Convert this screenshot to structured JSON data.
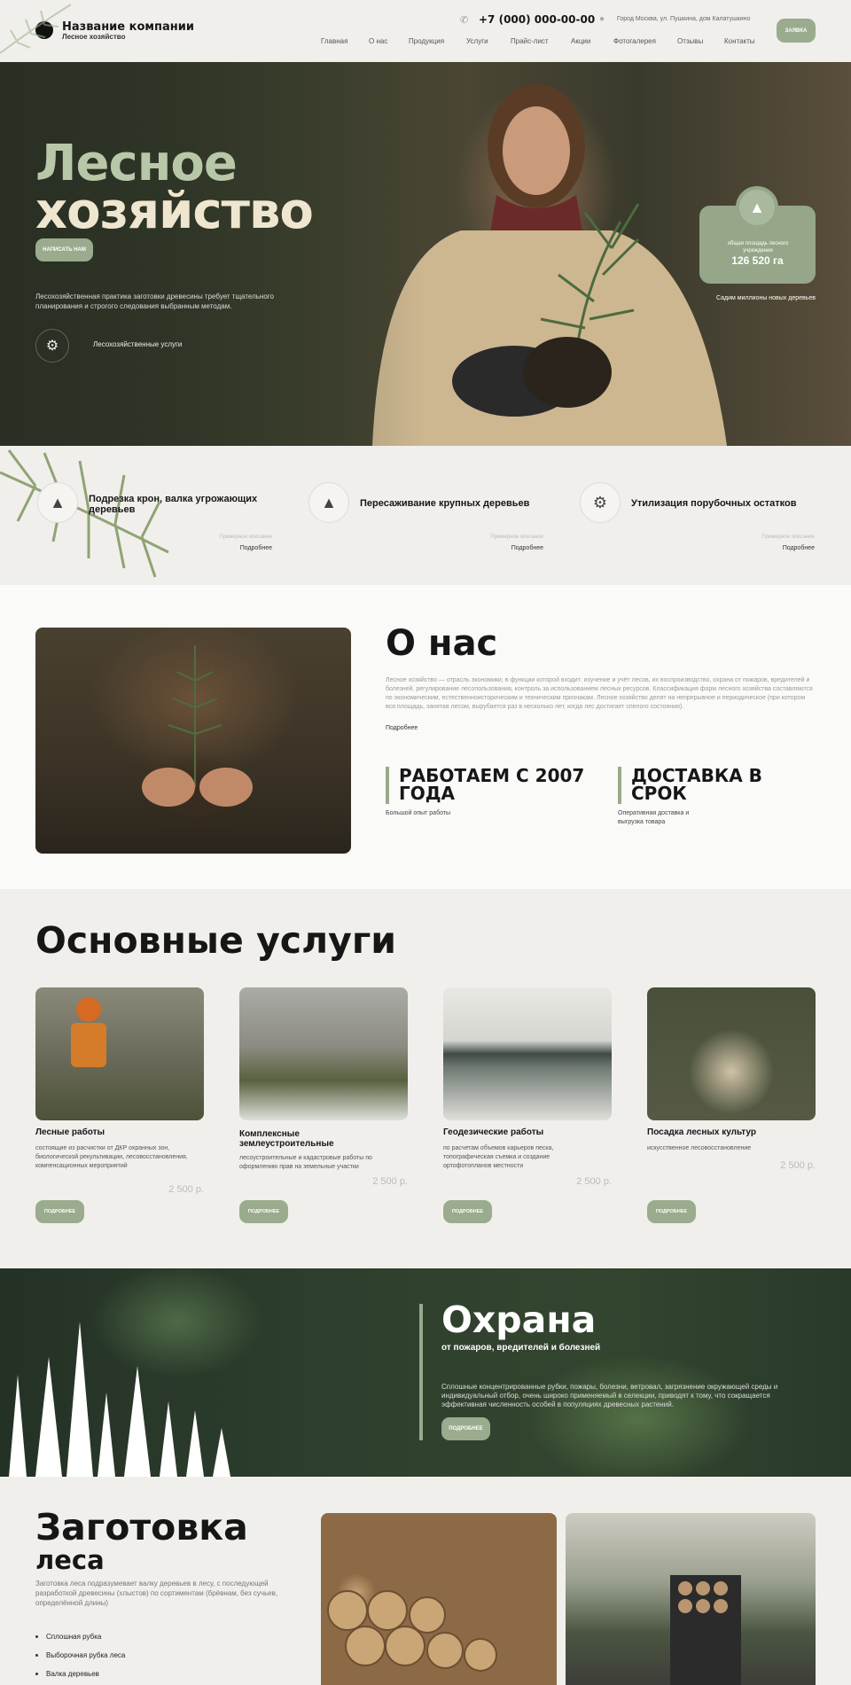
{
  "header": {
    "company_name": "Название компании",
    "company_sub": "Лесное хозяйство",
    "phone": "+7 (000) 000-00-00",
    "address": "Город Москва, ул. Пушкина, дом Калатушкино",
    "cta": "ЗАЯВКА",
    "nav": [
      "Главная",
      "О нас",
      "Продукция",
      "Услуги",
      "Прайс-лист",
      "Акции",
      "Фотогалерея",
      "Отзывы",
      "Контакты"
    ]
  },
  "hero": {
    "title_line1": "Лесное",
    "title_line2": "хозяйство",
    "button": "НАПИСАТЬ НАМ",
    "description": "Лесохозяйственная практика заготовки древесины требует тщательного планирования и строгого следования выбранным методам.",
    "service_label": "Лесохозяйственные услуги",
    "stat_label": "общая площадь лесного учреждения",
    "stat_value": "126 520 га",
    "stat_caption": "Садим миллионы новых деревьев"
  },
  "features": [
    {
      "title": "Подрезка крон, валка угрожающих деревьев",
      "sample": "Примерное описание",
      "more": "Подробнее"
    },
    {
      "title": "Пересаживание крупных деревьев",
      "sample": "Примерное описание",
      "more": "Подробнее"
    },
    {
      "title": "Утилизация порубочных остатков",
      "sample": "Примерное описание",
      "more": "Подробнее"
    }
  ],
  "about": {
    "title": "О нас",
    "text": "Лесное хозяйство — отрасль экономики, в функции которой входит: изучение и учёт лесов, их воспроизводство, охрана от пожаров, вредителей и болезней, регулирование лесопользования, контроль за использованием лесных ресурсов. Классификация форм лесного хозяйства составляются по экономическим, естественноисторическим и техническим признакам. Лесное хозяйство делят на непрерывное и периодическое (при котором вся площадь, занятая лесом, вырубается раз в несколько лет, когда лес достигает спелого состояния).",
    "more": "Подробнее",
    "h1": "РАБОТАЕМ С 2007 ГОДА",
    "s1": "Большой опыт работы",
    "h2": "ДОСТАВКА В СРОК",
    "s2": "Оперативная доставка и выгрузка товара"
  },
  "services": {
    "title": "Основные услуги",
    "items": [
      {
        "name": "Лесные работы",
        "desc": "состоящие из расчистки от ДКР охранных зон, биологической рекультивации, лесовосстановления, компенсационных мероприятий",
        "price": "2 500  р.",
        "button": "ПОДРОБНЕЕ"
      },
      {
        "name": "Комплексные землеустроительные",
        "desc": "лесоустроительные и кадастровые работы по оформлению прав на земельные участки",
        "price": "2 500  р.",
        "button": "ПОДРОБНЕЕ"
      },
      {
        "name": "Геодезические работы",
        "desc": "по расчетам объемов карьеров песка, топографическая съемка и создание ортофотопланов местности",
        "price": "2 500  р.",
        "button": "ПОДРОБНЕЕ"
      },
      {
        "name": "Посадка лесных культур",
        "desc": "искусственное лесовосстановление",
        "price": "2 500  р.",
        "button": "ПОДРОБНЕЕ"
      }
    ]
  },
  "protect": {
    "title": "Охрана",
    "subtitle": "от пожаров, вредителей и болезней",
    "text": "Сплошные концентрированные рубки, пожары, болезни, ветровал, загрязнение окружающей среды и индивидуальный отбор, очень широко применяемый в селекции, приводят к тому, что сокращается эффективная численность особей в популяциях древесных растений.",
    "button": "ПОДРОБНЕЕ"
  },
  "harvest": {
    "title": "Заготовка",
    "subtitle": "леса",
    "desc": "Заготовка леса подразумевает валку деревьев в лесу, с последующей разработкой древесины (хлыстов) по сортиментам (брёвнам, без сучьев, определённой длины)",
    "list": [
      "Сплошная рубка",
      "Выборочная рубка леса",
      "Валка деревьев"
    ]
  },
  "colors": {
    "accent": "#98a98c",
    "background": "#f1efec",
    "hero_title_green": "#b9c7a9",
    "hero_title_cream": "#efe6cf"
  },
  "icons": [
    "phone-icon",
    "location-pin-icon",
    "harvester-icon",
    "tree-icon",
    "trees-icon",
    "forestry-machine-icon"
  ]
}
